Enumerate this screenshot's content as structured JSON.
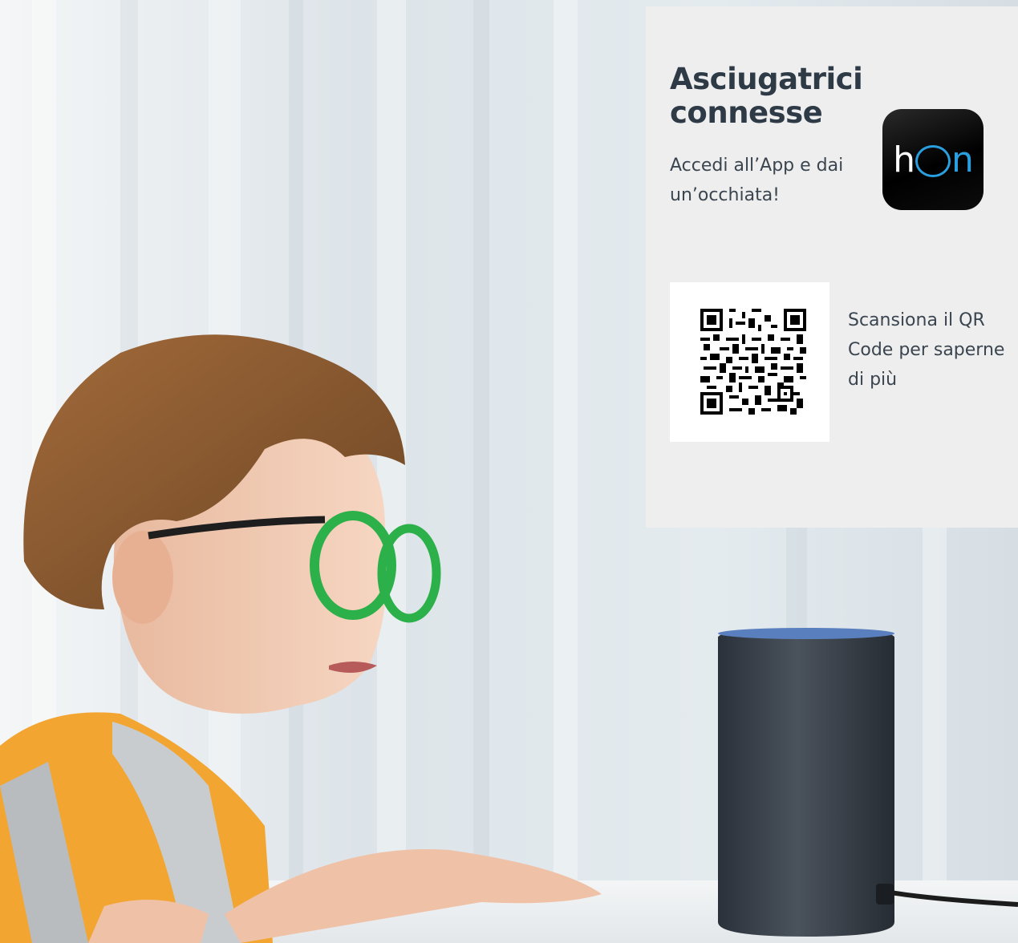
{
  "panel": {
    "title": "Asciugatrici connesse",
    "subtitle": "Accedi all’App e dai un’occhiata!",
    "app_icon": {
      "name": "hon-app-icon",
      "text_prefix": "h",
      "text_suffix": "n",
      "accent_color": "#2a9fe0",
      "background_color": "#000000"
    },
    "qr": {
      "icon": "qr-code-icon",
      "caption": "Scansiona il QR Code per saperne di più"
    }
  },
  "colors": {
    "panel_background": "#eeeeee",
    "heading": "#2e3b47",
    "body_text": "#3a4550"
  }
}
